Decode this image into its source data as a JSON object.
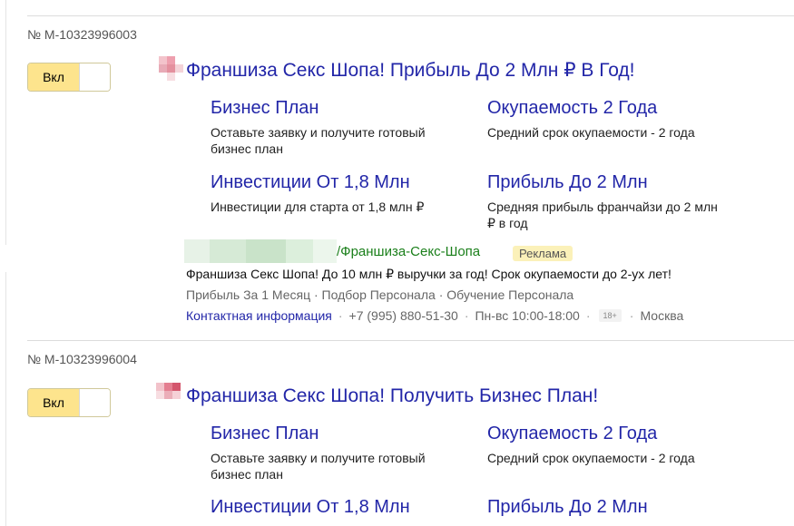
{
  "ads": [
    {
      "id_label": "№ М-10323996003",
      "toggle_label": "Вкл",
      "title": "Франшиза Секс Шопа! Прибыль До 2 Млн ₽ В Год!",
      "sitelinks": [
        {
          "title": "Бизнес План",
          "desc": "Оставьте заявку и получите готовый бизнес план"
        },
        {
          "title": "Окупаемость 2 Года",
          "desc": "Средний срок окупаемости - 2 года"
        },
        {
          "title": "Инвестиции От 1,8 Млн",
          "desc": "Инвестиции для старта от 1,8 млн ₽"
        },
        {
          "title": "Прибыль До 2 Млн",
          "desc": "Средняя прибыль франчайзи до 2 млн ₽ в год"
        }
      ],
      "url_path": "/Франшиза-Секс-Шопа",
      "ad_badge": "Реклама",
      "body": "Франшиза Секс Шопа! До 10 млн ₽ выручки за год! Срок окупаемости до 2-ух лет!",
      "extra_links": "Прибыль За 1 Месяц · Подбор Персонала · Обучение Персонала",
      "contact_link": "Контактная информация",
      "phone": "+7 (995) 880-51-30",
      "hours": "Пн-вс 10:00-18:00",
      "age": "18+",
      "city": "Москва"
    },
    {
      "id_label": "№ М-10323996004",
      "toggle_label": "Вкл",
      "title": "Франшиза Секс Шопа! Получить Бизнес План!",
      "sitelinks": [
        {
          "title": "Бизнес План",
          "desc": "Оставьте заявку и получите готовый бизнес план"
        },
        {
          "title": "Окупаемость 2 Года",
          "desc": "Средний срок окупаемости - 2 года"
        },
        {
          "title": "Инвестиции От 1,8 Млн",
          "desc": ""
        },
        {
          "title": "Прибыль До 2 Млн",
          "desc": ""
        }
      ]
    }
  ],
  "colors": {
    "link": "#2226a8",
    "url_green": "#1a7f1a",
    "toggle_on": "#fde48d",
    "badge_bg": "#fbf1b9"
  }
}
